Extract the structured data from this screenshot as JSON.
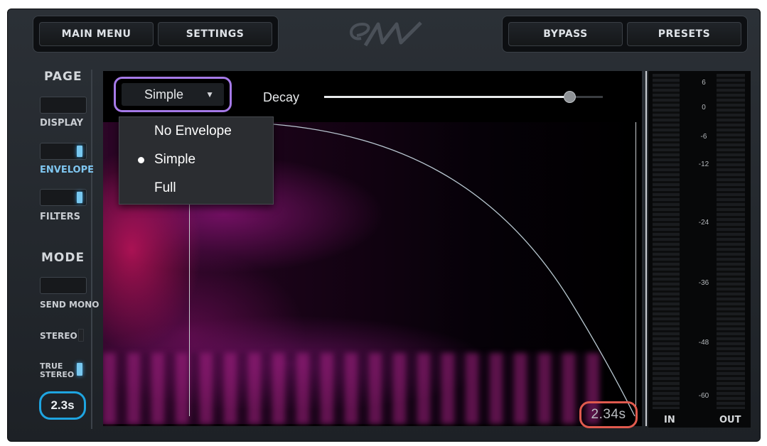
{
  "top_bar": {
    "main_menu": "MAIN MENU",
    "settings": "SETTINGS",
    "bypass": "BYPASS",
    "presets": "PRESETS"
  },
  "sidebar": {
    "page_heading": "PAGE",
    "display": "DISPLAY",
    "envelope": "ENVELOPE",
    "filters": "FILTERS",
    "mode_heading": "MODE",
    "send_mono": "SEND MONO",
    "stereo": "STEREO",
    "true_stereo_1": "TRUE",
    "true_stereo_2": "STEREO",
    "time_badge": "2.3s"
  },
  "envelope": {
    "selected": "Simple",
    "options": [
      "No Envelope",
      "Simple",
      "Full"
    ],
    "decay_label": "Decay",
    "decay_value": 0.88,
    "time_readout": "2.34s"
  },
  "meter": {
    "scale": [
      "6",
      "0",
      "-6",
      "-12",
      "-24",
      "-36",
      "-48",
      "-60"
    ],
    "in_label": "IN",
    "out_label": "OUT"
  },
  "colors": {
    "accent_blue": "#1ea4e0",
    "accent_purple": "#a67ae8",
    "accent_red": "#e05a4e"
  }
}
